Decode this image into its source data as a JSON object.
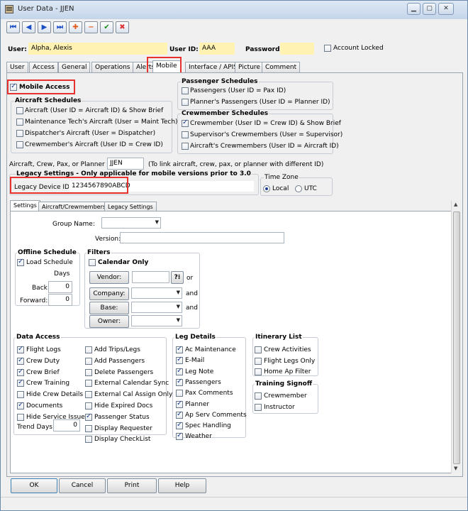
{
  "window": {
    "title": "User Data - JJEN"
  },
  "toolbar": {
    "first": "⏮",
    "prev": "◀",
    "next": "▶",
    "last": "⏭",
    "add": "✚",
    "remove": "−",
    "confirm": "✔",
    "cancel": "✖"
  },
  "header": {
    "user_label": "User:",
    "user_value": "Alpha, Alexis",
    "userid_label": "User ID:",
    "userid_value": "AAA",
    "password_label": "Password:",
    "password_value": "",
    "locked_label": "Account Locked",
    "locked": false
  },
  "main_tabs": [
    "User",
    "Access",
    "General",
    "Operations",
    "Alerts",
    "Mobile",
    "Interface / APIS",
    "Picture",
    "Comment"
  ],
  "main_tab_selected": "Mobile",
  "mobile": {
    "mobile_access_label": "Mobile Access",
    "mobile_access": true,
    "aircraft_schedules": {
      "title": "Aircraft Schedules",
      "items": [
        {
          "label": "Aircraft (User ID = Aircraft ID) & Show Brief",
          "checked": false
        },
        {
          "label": "Maintenance Tech's Aircraft (User = Maint Tech)",
          "checked": false
        },
        {
          "label": "Dispatcher's Aircraft (User = Dispatcher)",
          "checked": false
        },
        {
          "label": "Crewmember's Aircraft (User ID = Crew ID)",
          "checked": false
        }
      ]
    },
    "passenger_schedules": {
      "title": "Passenger Schedules",
      "items": [
        {
          "label": "Passengers (User ID = Pax ID)",
          "checked": false
        },
        {
          "label": "Planner's Passengers (User ID = Planner ID)",
          "checked": false
        }
      ]
    },
    "crewmember_schedules": {
      "title": "Crewmember Schedules",
      "items": [
        {
          "label": "Crewmember (User ID = Crew ID) & Show Brief",
          "checked": true
        },
        {
          "label": "Supervisor's Crewmembers (User = Supervisor)",
          "checked": false
        },
        {
          "label": "Aircraft's Crewmembers (User ID = Aircraft ID)",
          "checked": false
        }
      ]
    },
    "link_label": "Aircraft, Crew, Pax, or Planner ID:",
    "link_value": "JJEN",
    "link_hint": "(To link aircraft, crew, pax, or planner with different ID)",
    "legacy_title": "Legacy Settings - Only applicable for mobile versions prior to 3.0",
    "legacy_device_label": "Legacy Device ID:",
    "legacy_device_value": "1234567890ABCD",
    "timezone_title": "Time Zone",
    "tz_local": "Local",
    "tz_utc": "UTC",
    "tz_selected": "Local"
  },
  "sub_tabs": [
    "Settings",
    "Aircraft/Crewmembers",
    "Legacy Settings"
  ],
  "sub_tab_selected": "Settings",
  "settings": {
    "group_name_label": "Group Name:",
    "group_name_value": "",
    "version_label": "Version:",
    "version_value": "",
    "offline": {
      "title": "Offline Schedule",
      "load_label": "Load Schedule",
      "load": true,
      "days_label": "Days",
      "back_label": "Back:",
      "back_value": "0",
      "forward_label": "Forward:",
      "forward_value": "0"
    },
    "filters": {
      "title": "Filters",
      "calendar_only_label": "Calendar Only",
      "calendar_only": false,
      "vendor_label": "Vendor:",
      "vendor_value": "",
      "vendor_btn": "?⁝",
      "or_label": "or",
      "company_label": "Company:",
      "and1": "and",
      "base_label": "Base:",
      "and2": "and",
      "owner_label": "Owner:"
    },
    "data_access": {
      "title": "Data Access",
      "col1": [
        {
          "label": "Flight Logs",
          "checked": true
        },
        {
          "label": "Crew Duty",
          "checked": true
        },
        {
          "label": "Crew Brief",
          "checked": true
        },
        {
          "label": "Crew Training",
          "checked": true
        },
        {
          "label": "Hide Crew Details",
          "checked": false
        },
        {
          "label": "Documents",
          "checked": true
        },
        {
          "label": "Hide Service Issues",
          "checked": false
        }
      ],
      "col2": [
        {
          "label": "Add Trips/Legs",
          "checked": false
        },
        {
          "label": "Add Passengers",
          "checked": false
        },
        {
          "label": "Delete Passengers",
          "checked": false
        },
        {
          "label": "External Calendar Sync",
          "checked": false
        },
        {
          "label": "External Cal Assign Only",
          "checked": false
        },
        {
          "label": "Hide Expired Docs",
          "checked": false
        },
        {
          "label": "Passenger Status",
          "checked": true
        },
        {
          "label": "Display Requester",
          "checked": false
        },
        {
          "label": "Display CheckList",
          "checked": false
        }
      ],
      "trend_days_label": "Trend Days:",
      "trend_days_value": "0"
    },
    "leg_details": {
      "title": "Leg Details",
      "items": [
        {
          "label": "Ac Maintenance",
          "checked": true
        },
        {
          "label": "E-Mail",
          "checked": true
        },
        {
          "label": "Leg Note",
          "checked": true
        },
        {
          "label": "Passengers",
          "checked": true
        },
        {
          "label": "Pax Comments",
          "checked": false
        },
        {
          "label": "Planner",
          "checked": true
        },
        {
          "label": "Ap Serv Comments",
          "checked": true
        },
        {
          "label": "Spec Handling",
          "checked": true
        },
        {
          "label": "Weather",
          "checked": true
        }
      ]
    },
    "itinerary": {
      "title": "Itinerary List",
      "items": [
        {
          "label": "Crew Activities",
          "checked": false
        },
        {
          "label": "Flight Legs Only",
          "checked": false
        },
        {
          "label": "Home Ap Filter",
          "checked": false
        }
      ]
    },
    "training": {
      "title": "Training Signoff",
      "items": [
        {
          "label": "Crewmember",
          "checked": false
        },
        {
          "label": "Instructor",
          "checked": false
        }
      ]
    }
  },
  "footer": {
    "ok": "OK",
    "cancel": "Cancel",
    "print": "Print",
    "help": "Help"
  }
}
